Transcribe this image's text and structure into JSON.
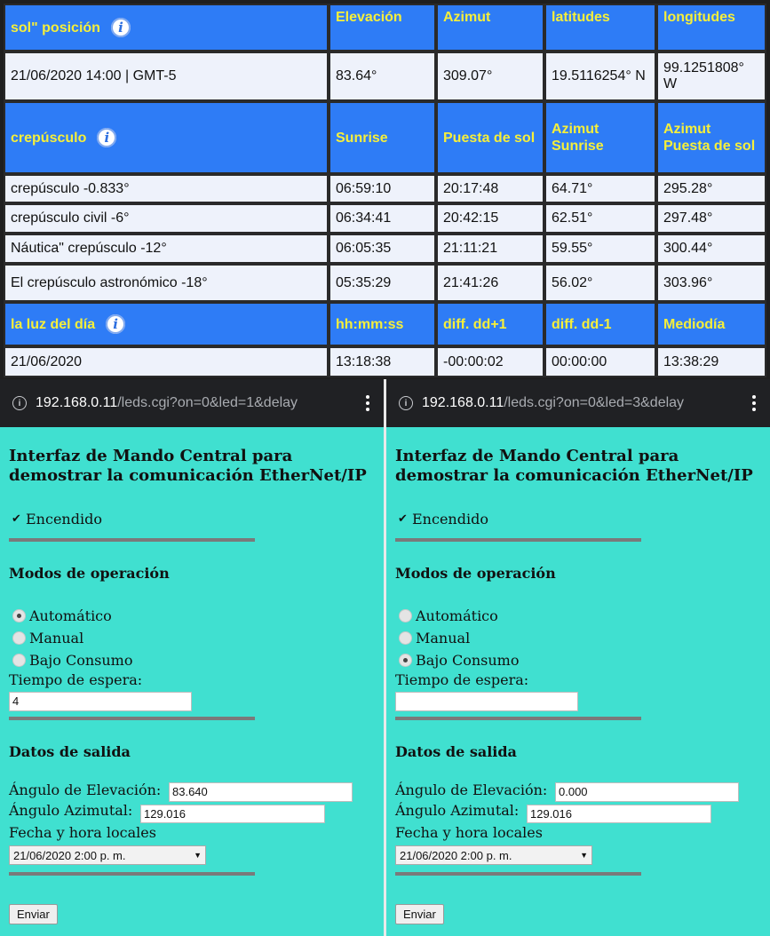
{
  "sun_table": {
    "headers1": {
      "label": "sol\" posición",
      "elevation": "Elevación",
      "azimuth": "Azimut",
      "latitude": "latitudes",
      "longitude": "longitudes"
    },
    "position_row": {
      "datetime": "21/06/2020   14:00 | GMT-5",
      "elevation": "83.64°",
      "azimuth": "309.07°",
      "latitude": "19.5116254° N",
      "longitude": "99.1251808° W"
    },
    "headers2": {
      "label": "crepúsculo",
      "sunrise": "Sunrise",
      "sunset": "Puesta de sol",
      "az_sunrise": "Azimut Sunrise",
      "az_sunset": "Azimut Puesta de sol"
    },
    "twilight_rows": [
      {
        "name": "crepúsculo -0.833°",
        "sunrise": "06:59:10",
        "sunset": "20:17:48",
        "az_sunrise": "64.71°",
        "az_sunset": "295.28°"
      },
      {
        "name": "crepúsculo civil -6°",
        "sunrise": "06:34:41",
        "sunset": "20:42:15",
        "az_sunrise": "62.51°",
        "az_sunset": "297.48°"
      },
      {
        "name": "Náutica\" crepúsculo -12°",
        "sunrise": "06:05:35",
        "sunset": "21:11:21",
        "az_sunrise": "59.55°",
        "az_sunset": "300.44°"
      },
      {
        "name": "El crepúsculo astronómico -18°",
        "sunrise": "05:35:29",
        "sunset": "21:41:26",
        "az_sunrise": "56.02°",
        "az_sunset": "303.96°"
      }
    ],
    "headers3": {
      "label": "la luz del día",
      "duration": "hh:mm:ss",
      "diff_plus": "diff. dd+1",
      "diff_minus": "diff. dd-1",
      "noon": "Mediodía"
    },
    "daylight_row": {
      "date": "21/06/2020",
      "duration": "13:18:38",
      "diff_plus": "-00:00:02",
      "diff_minus": "00:00:00",
      "noon": "13:38:29"
    },
    "info_icon_name": "info-icon"
  },
  "left": {
    "url_host": "192.168.0.11",
    "url_path": "/leds.cgi?on=0&led=1&delay",
    "title_line1": "Interfaz de Mando Central para",
    "title_line2": "demostrar la comunicación EtherNet/IP",
    "checkbox_label": "Encendido",
    "checkbox_checked": true,
    "modes_heading": "Modos de operación",
    "mode_options": [
      "Automático",
      "Manual",
      "Bajo Consumo"
    ],
    "mode_selected": "Automático",
    "wait_label": "Tiempo de espera:",
    "wait_value": "4",
    "output_heading": "Datos de salida",
    "elev_label": "Ángulo de Elevación:",
    "elev_value": "83.640",
    "azim_label": "Ángulo Azimutal:",
    "azim_value": "129.016",
    "datetime_label": "Fecha y hora locales",
    "datetime_value": "21/06/2020 2:00 p. m.",
    "submit_label": "Enviar"
  },
  "right": {
    "url_host": "192.168.0.11",
    "url_path": "/leds.cgi?on=0&led=3&delay",
    "title_line1": "Interfaz de Mando Central para",
    "title_line2": "demostrar la comunicación EtherNet/IP",
    "checkbox_label": "Encendido",
    "checkbox_checked": true,
    "modes_heading": "Modos de operación",
    "mode_options": [
      "Automático",
      "Manual",
      "Bajo Consumo"
    ],
    "mode_selected": "Bajo Consumo",
    "wait_label": "Tiempo de espera:",
    "wait_value": "",
    "output_heading": "Datos de salida",
    "elev_label": "Ángulo de Elevación:",
    "elev_value": "0.000",
    "azim_label": "Ángulo Azimutal:",
    "azim_value": "129.016",
    "datetime_label": "Fecha y hora locales",
    "datetime_value": "21/06/2020 2:00 p. m.",
    "submit_label": "Enviar"
  },
  "colors": {
    "header_bg": "#2e7cf6",
    "header_text": "#f6ef3a",
    "page_bg": "#40e0d0",
    "urlbar_bg": "#202124"
  }
}
